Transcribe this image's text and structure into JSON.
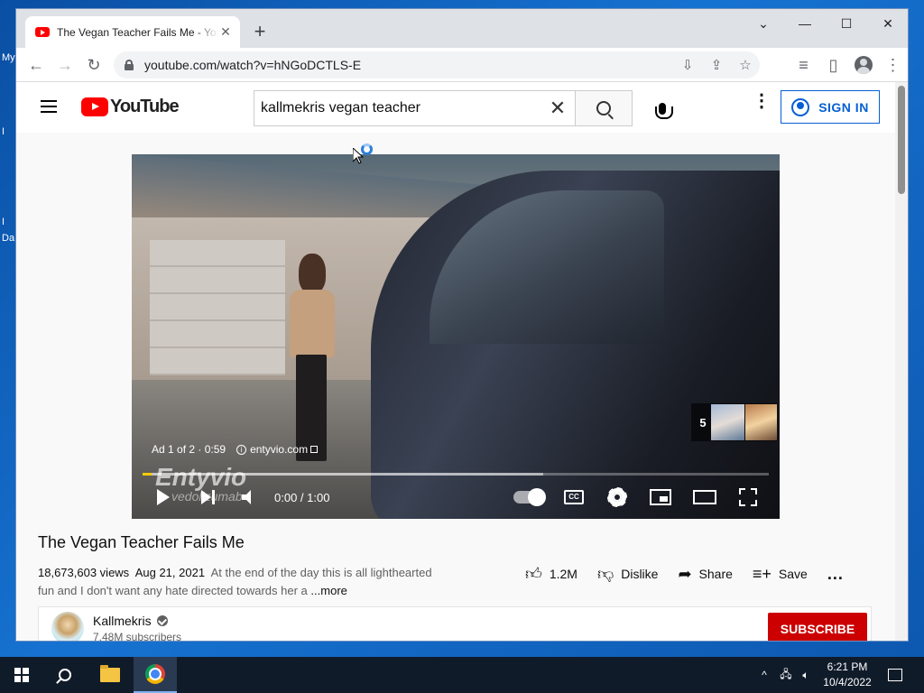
{
  "desktop": {
    "labels": [
      "My",
      "I",
      "I",
      "Da"
    ]
  },
  "browser": {
    "tab_title": "The Vegan Teacher Fails Me - YouTube",
    "new_tab": "+",
    "url": "youtube.com/watch?v=hNGoDCTLS-E",
    "window_controls": {
      "dropdown": "⌄",
      "minimize": "—",
      "maximize": "☐",
      "close": "✕"
    },
    "nav": {
      "back": "←",
      "forward": "→",
      "reload": "↻"
    },
    "icons": {
      "install": "⇩",
      "share": "⇪",
      "bookmark": "☆",
      "media": "≡",
      "sidepanel": "▯",
      "menu": "⋮"
    }
  },
  "youtube": {
    "logo_text": "YouTube",
    "search_query": "kallmekris vegan teacher",
    "clear": "✕",
    "sign_in": "SIGN IN",
    "more_menu": "⋮"
  },
  "player": {
    "ad_label": "Ad 1 of 2 · 0:59",
    "ad_domain": "entyvio.com",
    "brand_watermark": "Entyvio",
    "brand_sub": "vedolizumab",
    "skip_count": "5",
    "time": "0:00 / 1:00",
    "progress": {
      "played_fraction": 0.0,
      "loaded_fraction": 0.64
    }
  },
  "video": {
    "title": "The Vegan Teacher Fails Me",
    "views": "18,673,603 views",
    "date": "Aug 21, 2021",
    "description": "At the end of the day this is all lighthearted fun and I don't want any hate directed towards her a",
    "more": "...more",
    "likes": "1.2M",
    "dislike": "Dislike",
    "share": "Share",
    "save": "Save",
    "more_actions": "..."
  },
  "channel": {
    "name": "Kallmekris",
    "subscribers": "7.48M subscribers",
    "subscribe": "SUBSCRIBE"
  },
  "taskbar": {
    "time": "6:21 PM",
    "date": "10/4/2022",
    "tray_chevron": "^"
  },
  "colors": {
    "yt_red": "#ff0000",
    "subscribe_red": "#cc0000",
    "signin_blue": "#065fd4",
    "ad_progress": "#ffcc00"
  }
}
